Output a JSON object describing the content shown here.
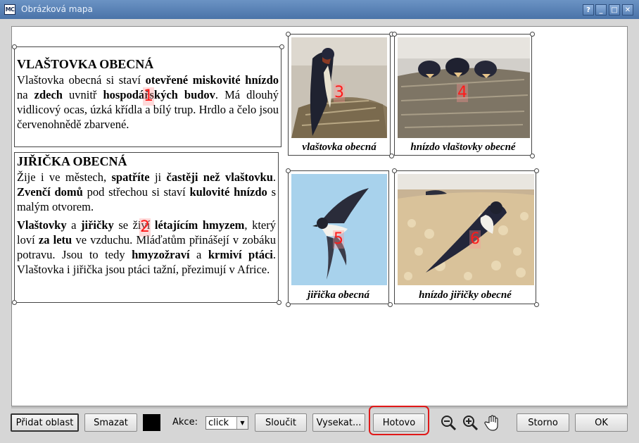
{
  "window": {
    "title": "Obrázková mapa",
    "app_icon_text": "MC",
    "controls": [
      "?",
      "_",
      "□",
      "✕"
    ]
  },
  "text_blocks": {
    "swallow": {
      "heading": "VLAŠTOVKA OBECNÁ",
      "p1_a": "Vlaštovka obecná si staví ",
      "p1_b": "otevřené miskovité hnízdo",
      "p1_c": " na ",
      "p1_d": "zdech",
      "p1_e": " uvnitř ",
      "p1_f": "hospodářských budov",
      "p1_g": ". Má dlouhý vidlicový ocas, úzká křídla a bílý trup. Hrdlo a čelo jsou červenohnědě zbarvené."
    },
    "martin": {
      "heading": "JIŘIČKA OBECNÁ",
      "p1_a": "Žije i ve městech, ",
      "p1_b": "spatříte",
      "p1_c": " ji ",
      "p1_d": "častěji než vlaštovku",
      "p1_e": ". ",
      "p1_f": "Zvenčí domů",
      "p1_g": " pod střechou si staví ",
      "p1_h": "kulovité hnízdo",
      "p1_i": " s malým otvorem.",
      "p2_a": "Vlaštovky",
      "p2_b": " a ",
      "p2_c": "jiřičky",
      "p2_d": " se živí ",
      "p2_e": "létajícím hmyzem",
      "p2_f": ", který loví ",
      "p2_g": "za letu",
      "p2_h": " ve vzduchu. Mláďatům přinášejí v zobáku potravu. Jsou to tedy ",
      "p2_i": "hmyzožraví",
      "p2_j": " a ",
      "p2_k": "krmiví ptáci",
      "p2_l": ". Vlaštovka i jiřička jsou ptáci tažní, přezimují v Africe."
    }
  },
  "photos": [
    {
      "caption": "vlaštovka obecná",
      "area": "3"
    },
    {
      "caption": "hnízdo vlaštovky obecné",
      "area": "4"
    },
    {
      "caption": "jiřička obecná",
      "area": "5"
    },
    {
      "caption": "hnízdo jiřičky obecné",
      "area": "6"
    }
  ],
  "areas": {
    "a1": "1",
    "a2": "2"
  },
  "toolbar": {
    "add_area": "Přidat oblast",
    "delete": "Smazat",
    "color": "#000000",
    "action_label": "Akce:",
    "action_value": "click",
    "merge": "Sloučit",
    "cut": "Vysekat...",
    "done": "Hotovo",
    "zoom_out_icon": "zoom-out-icon",
    "zoom_in_icon": "zoom-in-icon",
    "pan_icon": "hand-icon",
    "cancel": "Storno",
    "ok": "OK",
    "highlight_color": "#e01818"
  }
}
